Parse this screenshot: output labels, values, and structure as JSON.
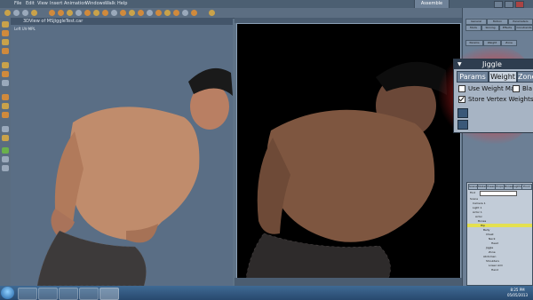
{
  "menubar": {
    "items": [
      "File",
      "Edit",
      "View",
      "Insert",
      "Animation",
      "Windows",
      "Walk",
      "Help"
    ],
    "active_tab": "Assemble"
  },
  "viewport1": {
    "title": "3DView of MSJiggleTest.car",
    "subtitle": "Left UV-MPL"
  },
  "right_panel": {
    "tabs_row1": [
      "General",
      "Motion",
      "Parameters"
    ],
    "tabs_row2": [
      "Mods",
      "Skining",
      "Effects",
      "Constraints"
    ],
    "tabs_row3": [
      "Params",
      "Weight",
      "Zone"
    ]
  },
  "jiggle": {
    "title": "Jiggle",
    "tabs": [
      "Params",
      "Weight",
      "Zone"
    ],
    "active_tab": "Weight",
    "use_weight_map": "Use Weight Map",
    "blend_label": "Bla",
    "store_vertex_weights": "Store Vertex Weights",
    "use_weight_map_checked": false,
    "store_vertex_weights_checked": true
  },
  "scene_tree": {
    "tabs": [
      "Scene",
      "Models",
      "Poses",
      "Props",
      "Bones",
      "Lights",
      "Envir"
    ],
    "filter_label": "Find",
    "items": [
      "Scene",
      "Camera 1",
      "Light 1",
      "Actor 1",
      "Actor",
      "Bones",
      "Hip",
      "Belly",
      "Chest",
      "Neck",
      "Head",
      "Jiggle",
      "Zone",
      "Abdomen",
      "Shoulders",
      "Lower Arm",
      "Hand"
    ]
  },
  "taskbar": {
    "time": "8:25 PM",
    "date": "05/05/2013"
  },
  "colors": {
    "accent_glow": "#ff2828",
    "viewport_bg": "#5a6e85",
    "render_bg": "#000000"
  }
}
